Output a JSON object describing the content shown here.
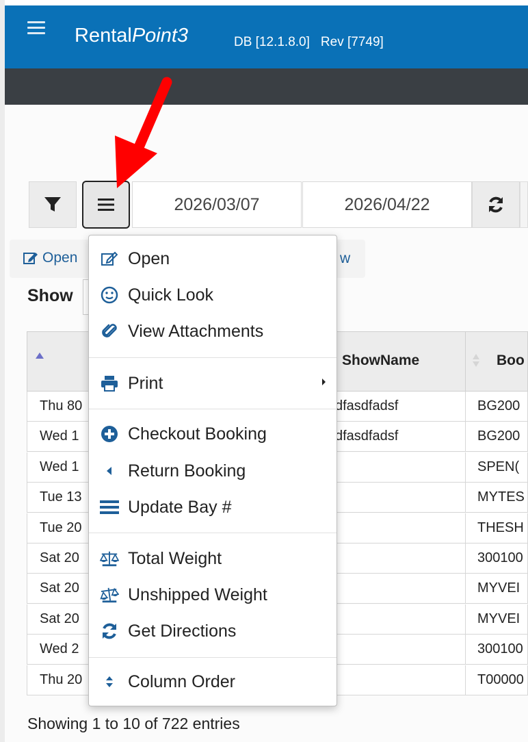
{
  "app": {
    "brand_plain": "Rental",
    "brand_italic": "Point3",
    "db": "DB [12.1.8.0]",
    "rev": "Rev [7749]"
  },
  "colors": {
    "header": "#0a71b7",
    "darkbar": "#3a3f44",
    "icon_blue": "#1e5f99",
    "arrow": "#ff0000"
  },
  "toolbar": {
    "filter_icon": "filter-icon",
    "menu_icon": "menu-icon",
    "date_from": "2026/03/07",
    "date_to": "2026/04/22",
    "refresh_icon": "refresh-icon"
  },
  "actionbar": {
    "open_label": "Open",
    "trailing_fragment": "w"
  },
  "show_label": "Show",
  "table": {
    "col_showname": "ShowName",
    "col_booking_fragment": "Boo",
    "rows": [
      {
        "date": "Thu 80",
        "show": "sdfasdfadsf",
        "booking": "BG200"
      },
      {
        "date": "Wed 1",
        "show": "sdfasdfadsf",
        "booking": "BG200"
      },
      {
        "date": "Wed 1",
        "show": "",
        "booking": "SPEN("
      },
      {
        "date": "Tue 13",
        "show": "",
        "booking": "MYTES"
      },
      {
        "date": "Tue 20",
        "show": "",
        "booking": "THESH"
      },
      {
        "date": "Sat 20",
        "show": "",
        "booking": "300100"
      },
      {
        "date": "Sat 20",
        "show": "",
        "booking": "MYVEI"
      },
      {
        "date": "Sat 20",
        "show": "",
        "booking": "MYVEI"
      },
      {
        "date": "Wed 2",
        "show": "",
        "booking": "300100"
      },
      {
        "date": "Thu 20",
        "show": "",
        "booking": "T00000"
      }
    ]
  },
  "footer": "Showing 1 to 10 of 722 entries",
  "menu": {
    "items": [
      {
        "label": "Open",
        "icon": "edit-icon"
      },
      {
        "label": "Quick Look",
        "icon": "smile-icon"
      },
      {
        "label": "View Attachments",
        "icon": "paperclip-icon"
      },
      {
        "label": "Print",
        "icon": "print-icon"
      },
      {
        "label": "Checkout Booking",
        "icon": "plus-circle-icon"
      },
      {
        "label": "Return Booking",
        "icon": "caret-left-icon"
      },
      {
        "label": "Update Bay #",
        "icon": "bars-icon"
      },
      {
        "label": "Total Weight",
        "icon": "balance-scale-icon"
      },
      {
        "label": "Unshipped Weight",
        "icon": "balance-scale-icon"
      },
      {
        "label": "Get Directions",
        "icon": "refresh-icon"
      },
      {
        "label": "Column Order",
        "icon": "sort-icon"
      }
    ]
  }
}
